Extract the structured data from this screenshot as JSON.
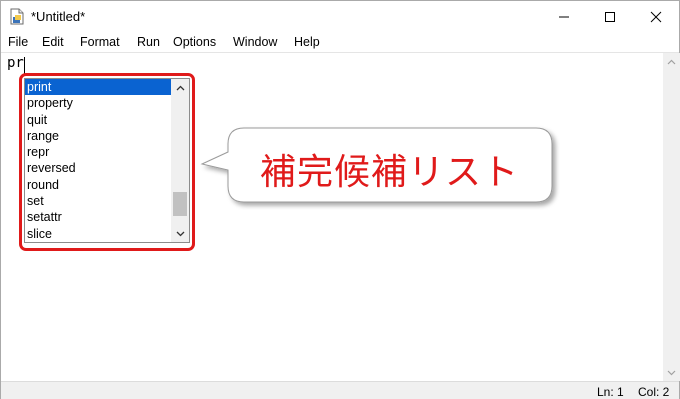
{
  "window": {
    "title": "*Untitled*",
    "icon": "idle-file-icon"
  },
  "menu": {
    "items": [
      "File",
      "Edit",
      "Format",
      "Run",
      "Options",
      "Window",
      "Help"
    ]
  },
  "editor": {
    "text": "pr"
  },
  "autocomplete": {
    "items": [
      "print",
      "property",
      "quit",
      "range",
      "repr",
      "reversed",
      "round",
      "set",
      "setattr",
      "slice"
    ],
    "selected_index": 0,
    "highlight_color": "#e01a1a",
    "selection_color": "#0a63d1"
  },
  "callout": {
    "text": "補完候補リスト",
    "text_color": "#e01a1a"
  },
  "status": {
    "line": "Ln: 1",
    "col": "Col: 2"
  }
}
